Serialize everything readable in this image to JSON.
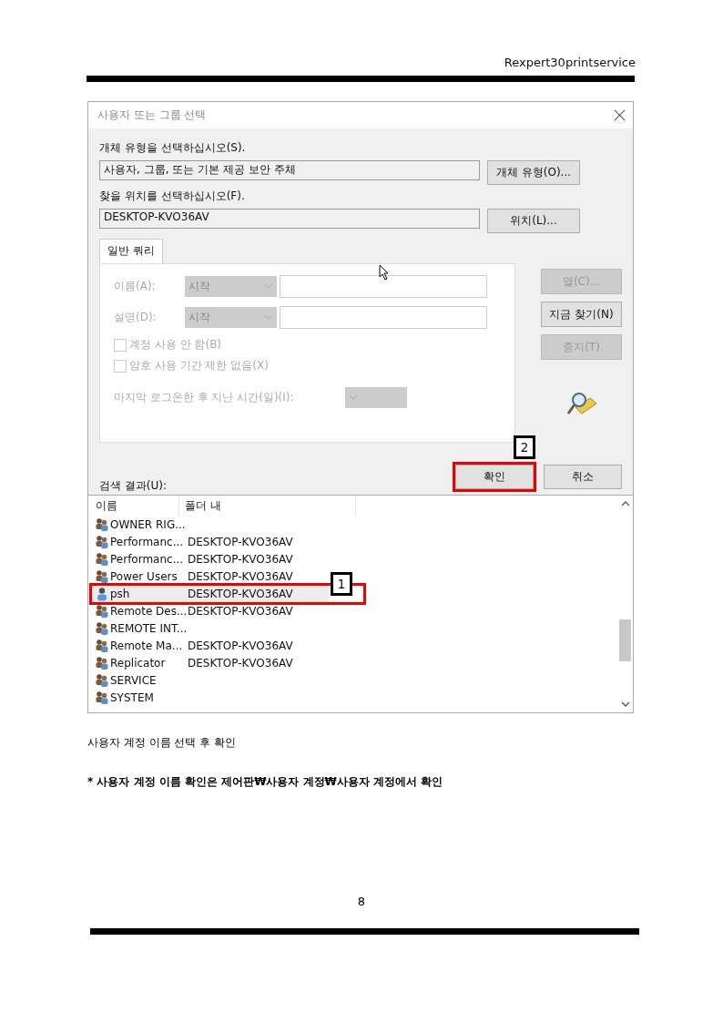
{
  "header": {
    "title": "Rexpert30printservice"
  },
  "dialog": {
    "title": "사용자 또는 그룹 선택",
    "object_type": {
      "label": "개체 유형을 선택하십시오(S).",
      "value": "사용자, 그룹, 또는 기본 제공 보안 주체",
      "button": "개체 유형(O)..."
    },
    "location": {
      "label": "찾을 위치를 선택하십시오(F).",
      "value": "DESKTOP-KVO36AV",
      "button": "위치(L)..."
    },
    "tabs": [
      {
        "label": "일반 쿼리",
        "selected": true
      }
    ],
    "query": {
      "disabled": true,
      "fields": [
        {
          "label": "이름(A):",
          "mode": "시작"
        },
        {
          "label": "설명(D):",
          "mode": "시작"
        }
      ],
      "checkboxes": [
        {
          "label": "계정 사용 안 함(B)",
          "checked": false
        },
        {
          "label": "암호 사용 기간 제한 없음(X)",
          "checked": false
        }
      ],
      "last_logon": {
        "label": "마지막 로그온한 후 지난 시간(일)(I):"
      }
    },
    "side_buttons": [
      {
        "label": "열(C)...",
        "disabled": true
      },
      {
        "label": "지금 찾기(N)",
        "disabled": false
      },
      {
        "label": "중지(T)",
        "disabled": true
      }
    ],
    "ok_button": {
      "label": "확인",
      "annotation": "2"
    },
    "cancel_button": {
      "label": "취소"
    },
    "results": {
      "label": "검색 결과(U):",
      "columns": [
        "이름",
        "폴더 내"
      ],
      "rows": [
        {
          "name": "OWNER RIG...",
          "kind": "group",
          "selected": false
        },
        {
          "name": "Performanc...",
          "folder": "DESKTOP-KVO36AV",
          "kind": "group",
          "selected": false
        },
        {
          "name": "Performanc...",
          "folder": "DESKTOP-KVO36AV",
          "kind": "group",
          "selected": false
        },
        {
          "name": "Power Users",
          "folder": "DESKTOP-KVO36AV",
          "kind": "group",
          "selected": false
        },
        {
          "name": "psh",
          "folder": "DESKTOP-KVO36AV",
          "kind": "user",
          "selected": true,
          "annotation": "1"
        },
        {
          "name": "Remote Des...",
          "folder": "DESKTOP-KVO36AV",
          "kind": "group",
          "selected": false
        },
        {
          "name": "REMOTE INT...",
          "kind": "group",
          "selected": false
        },
        {
          "name": "Remote Ma...",
          "folder": "DESKTOP-KVO36AV",
          "kind": "group",
          "selected": false
        },
        {
          "name": "Replicator",
          "folder": "DESKTOP-KVO36AV",
          "kind": "group",
          "selected": false
        },
        {
          "name": "SERVICE",
          "kind": "group",
          "selected": false
        },
        {
          "name": "SYSTEM",
          "kind": "group",
          "selected": false
        }
      ]
    }
  },
  "caption": "사용자 계정 이름 선택 후 확인",
  "note": "* 사용자 계정 이름 확인은 제어판₩사용자 계정₩사용자 계정에서 확인",
  "page_number": "8"
}
